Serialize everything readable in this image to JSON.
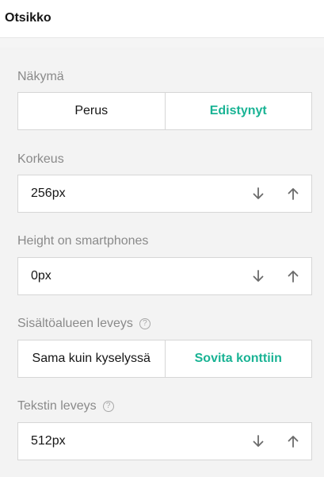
{
  "header": {
    "title": "Otsikko"
  },
  "view": {
    "label": "Näkymä",
    "options": [
      "Perus",
      "Edistynyt"
    ],
    "selected": "Edistynyt"
  },
  "height": {
    "label": "Korkeus",
    "value": "256px"
  },
  "height_smartphones": {
    "label": "Height on smartphones",
    "value": "0px"
  },
  "content_width": {
    "label": "Sisältöalueen leveys",
    "help_icon": "?",
    "options": [
      "Sama kuin kyselyssä",
      "Sovita konttiin"
    ],
    "selected": "Sovita konttiin"
  },
  "text_width": {
    "label": "Tekstin leveys",
    "help_icon": "?",
    "value": "512px"
  },
  "colors": {
    "accent": "#19b394",
    "label": "#8a8a8a",
    "border": "#d6d6d6"
  },
  "icons": {
    "decrement": "arrow-down-icon",
    "increment": "arrow-up-icon",
    "help": "question-circle-icon"
  }
}
